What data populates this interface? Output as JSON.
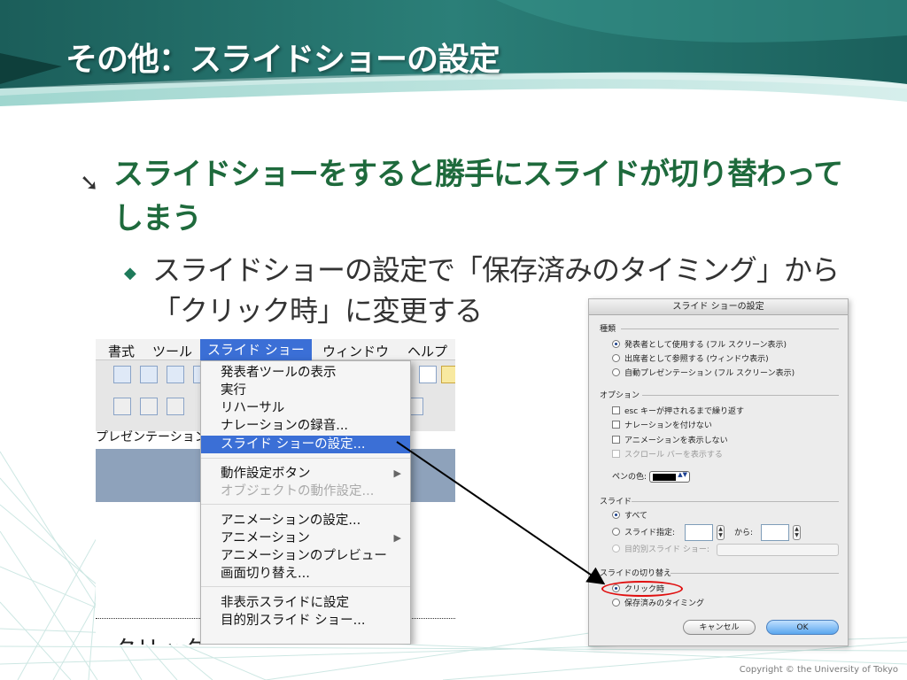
{
  "slide": {
    "title": "その他：スライドショーの設定",
    "bullet1": "スライドショーをすると勝手にスライドが切り替わってしまう",
    "bullet2": "スライドショーの設定で「保存済みのタイミング」から「クリック時」に変更する",
    "copyright": "Copyright © the University of Tokyo",
    "colors": {
      "title_green": "#1e6a3c",
      "header_teal": "#1f6d68",
      "menu_highlight": "#3b6fd6",
      "ellipse_red": "#e01010"
    }
  },
  "menu_screenshot": {
    "menubar": [
      "書式",
      "ツール",
      "スライド ショー",
      "ウィンドウ",
      "ヘルプ"
    ],
    "toolbar_label": "プレゼンテーション",
    "cut_text": "クリックしてタイトルを入力",
    "dropdown": [
      {
        "label": "発表者ツールの表示",
        "state": "normal"
      },
      {
        "label": "実行",
        "state": "normal"
      },
      {
        "label": "リハーサル",
        "state": "normal"
      },
      {
        "label": "ナレーションの録音...",
        "state": "normal"
      },
      {
        "label": "スライド ショーの設定...",
        "state": "selected"
      },
      {
        "label": "動作設定ボタン",
        "state": "submenu"
      },
      {
        "label": "オブジェクトの動作設定...",
        "state": "disabled"
      },
      {
        "label": "アニメーションの設定...",
        "state": "normal"
      },
      {
        "label": "アニメーション",
        "state": "submenu"
      },
      {
        "label": "アニメーションのプレビュー",
        "state": "normal"
      },
      {
        "label": "画面切り替え...",
        "state": "normal"
      },
      {
        "label": "非表示スライドに設定",
        "state": "normal"
      },
      {
        "label": "目的別スライド ショー...",
        "state": "normal"
      }
    ]
  },
  "dialog": {
    "title": "スライド ショーの設定",
    "type_group": "種類",
    "type_options": [
      {
        "label": "発表者として使用する (フル スクリーン表示)",
        "selected": true
      },
      {
        "label": "出席者として参照する (ウィンドウ表示)",
        "selected": false
      },
      {
        "label": "自動プレゼンテーション (フル スクリーン表示)",
        "selected": false
      }
    ],
    "options_group": "オプション",
    "options": [
      {
        "label": "esc キーが押されるまで繰り返す",
        "checked": false,
        "disabled": false
      },
      {
        "label": "ナレーションを付けない",
        "checked": false,
        "disabled": false
      },
      {
        "label": "アニメーションを表示しない",
        "checked": false,
        "disabled": false
      },
      {
        "label": "スクロール バーを表示する",
        "checked": false,
        "disabled": true
      }
    ],
    "pen_color_label": "ペンの色:",
    "slides_group": "スライド",
    "slide_all": "すべて",
    "slide_range": "スライド指定:",
    "slide_to": "から:",
    "slide_custom": "目的別スライド ショー:",
    "advance_group": "スライドの切り替え",
    "advance_options": [
      {
        "label": "クリック時",
        "selected": true
      },
      {
        "label": "保存済みのタイミング",
        "selected": false
      }
    ],
    "cancel_button": "キャンセル",
    "ok_button": "OK"
  }
}
